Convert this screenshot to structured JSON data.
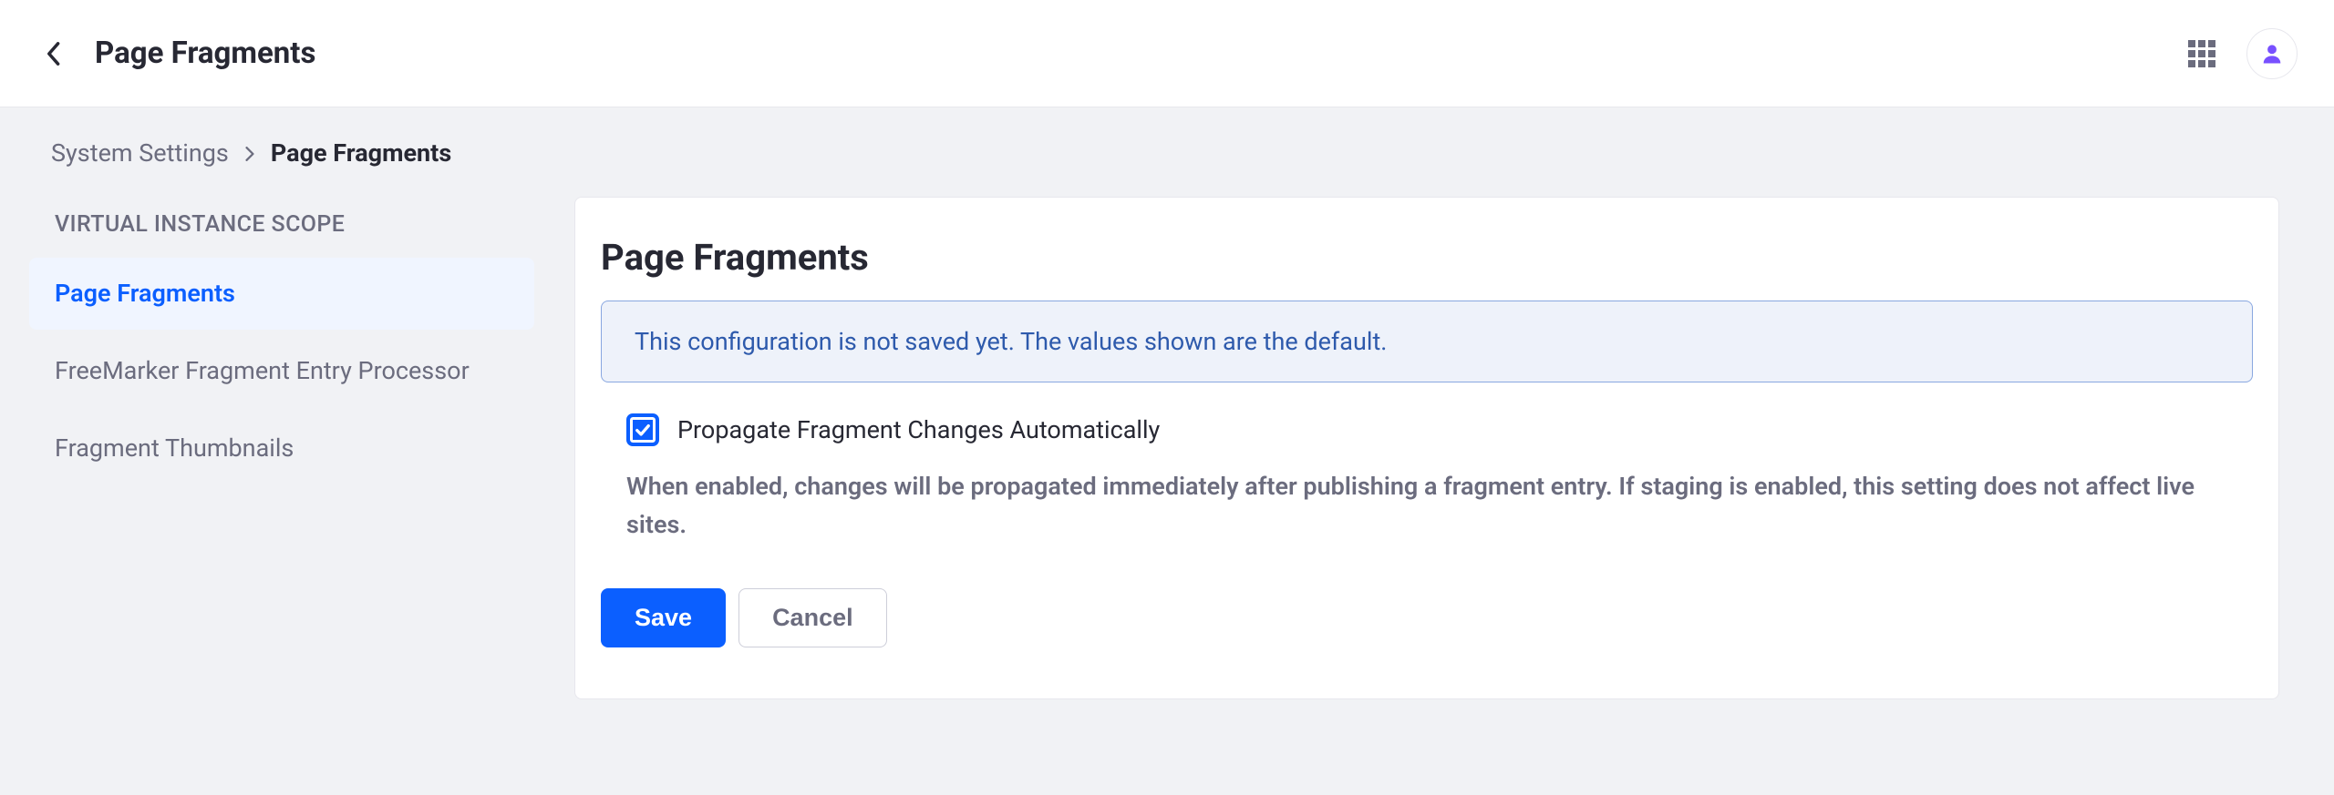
{
  "header": {
    "title": "Page Fragments"
  },
  "breadcrumb": {
    "root": "System Settings",
    "current": "Page Fragments"
  },
  "sidebar": {
    "scope_heading": "VIRTUAL INSTANCE SCOPE",
    "items": [
      {
        "label": "Page Fragments",
        "active": true
      },
      {
        "label": "FreeMarker Fragment Entry Processor",
        "active": false
      },
      {
        "label": "Fragment Thumbnails",
        "active": false
      }
    ]
  },
  "main": {
    "title": "Page Fragments",
    "alert": "This configuration is not saved yet. The values shown are the default.",
    "setting": {
      "label": "Propagate Fragment Changes Automatically",
      "checked": true,
      "description": "When enabled, changes will be propagated immediately after publishing a fragment entry. If staging is enabled, this setting does not affect live sites."
    },
    "actions": {
      "save": "Save",
      "cancel": "Cancel"
    }
  }
}
